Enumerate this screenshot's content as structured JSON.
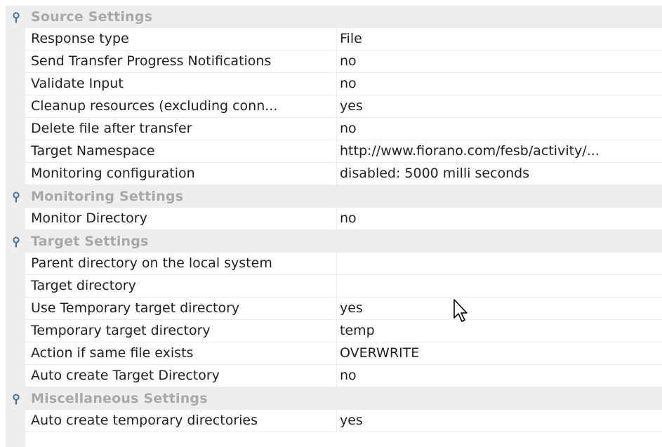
{
  "sections": [
    {
      "title": "Source Settings",
      "rows": [
        {
          "name": "Response type",
          "value": "File"
        },
        {
          "name": "Send Transfer Progress Notifications",
          "value": "no"
        },
        {
          "name": "Validate Input",
          "value": "no"
        },
        {
          "name": "Cleanup resources (excluding conn...",
          "value": "yes"
        },
        {
          "name": "Delete file after transfer",
          "value": "no"
        },
        {
          "name": "Target Namespace",
          "value": "http://www.fiorano.com/fesb/activity/..."
        },
        {
          "name": "Monitoring configuration",
          "value": "disabled: 5000 milli seconds"
        }
      ]
    },
    {
      "title": "Monitoring Settings",
      "rows": [
        {
          "name": "Monitor Directory",
          "value": "no"
        }
      ]
    },
    {
      "title": "Target Settings",
      "rows": [
        {
          "name": "Parent directory on the local system",
          "value": ""
        },
        {
          "name": "Target directory",
          "value": ""
        },
        {
          "name": "Use Temporary target directory",
          "value": "yes"
        },
        {
          "name": "Temporary target directory",
          "value": "temp"
        },
        {
          "name": "Action if same file exists",
          "value": "OVERWRITE"
        },
        {
          "name": "Auto create Target Directory",
          "value": "no"
        }
      ]
    },
    {
      "title": "Miscellaneous Settings",
      "rows": [
        {
          "name": "Auto create temporary directories",
          "value": "yes"
        }
      ]
    }
  ],
  "icons": {
    "section_toggle": "pin-icon",
    "pointer": "mouse-cursor-icon"
  },
  "colors": {
    "category_background": "#eeeeee",
    "category_text": "#a8a8a8",
    "pin": "#3d6fa8",
    "text": "#1f1f1f"
  }
}
